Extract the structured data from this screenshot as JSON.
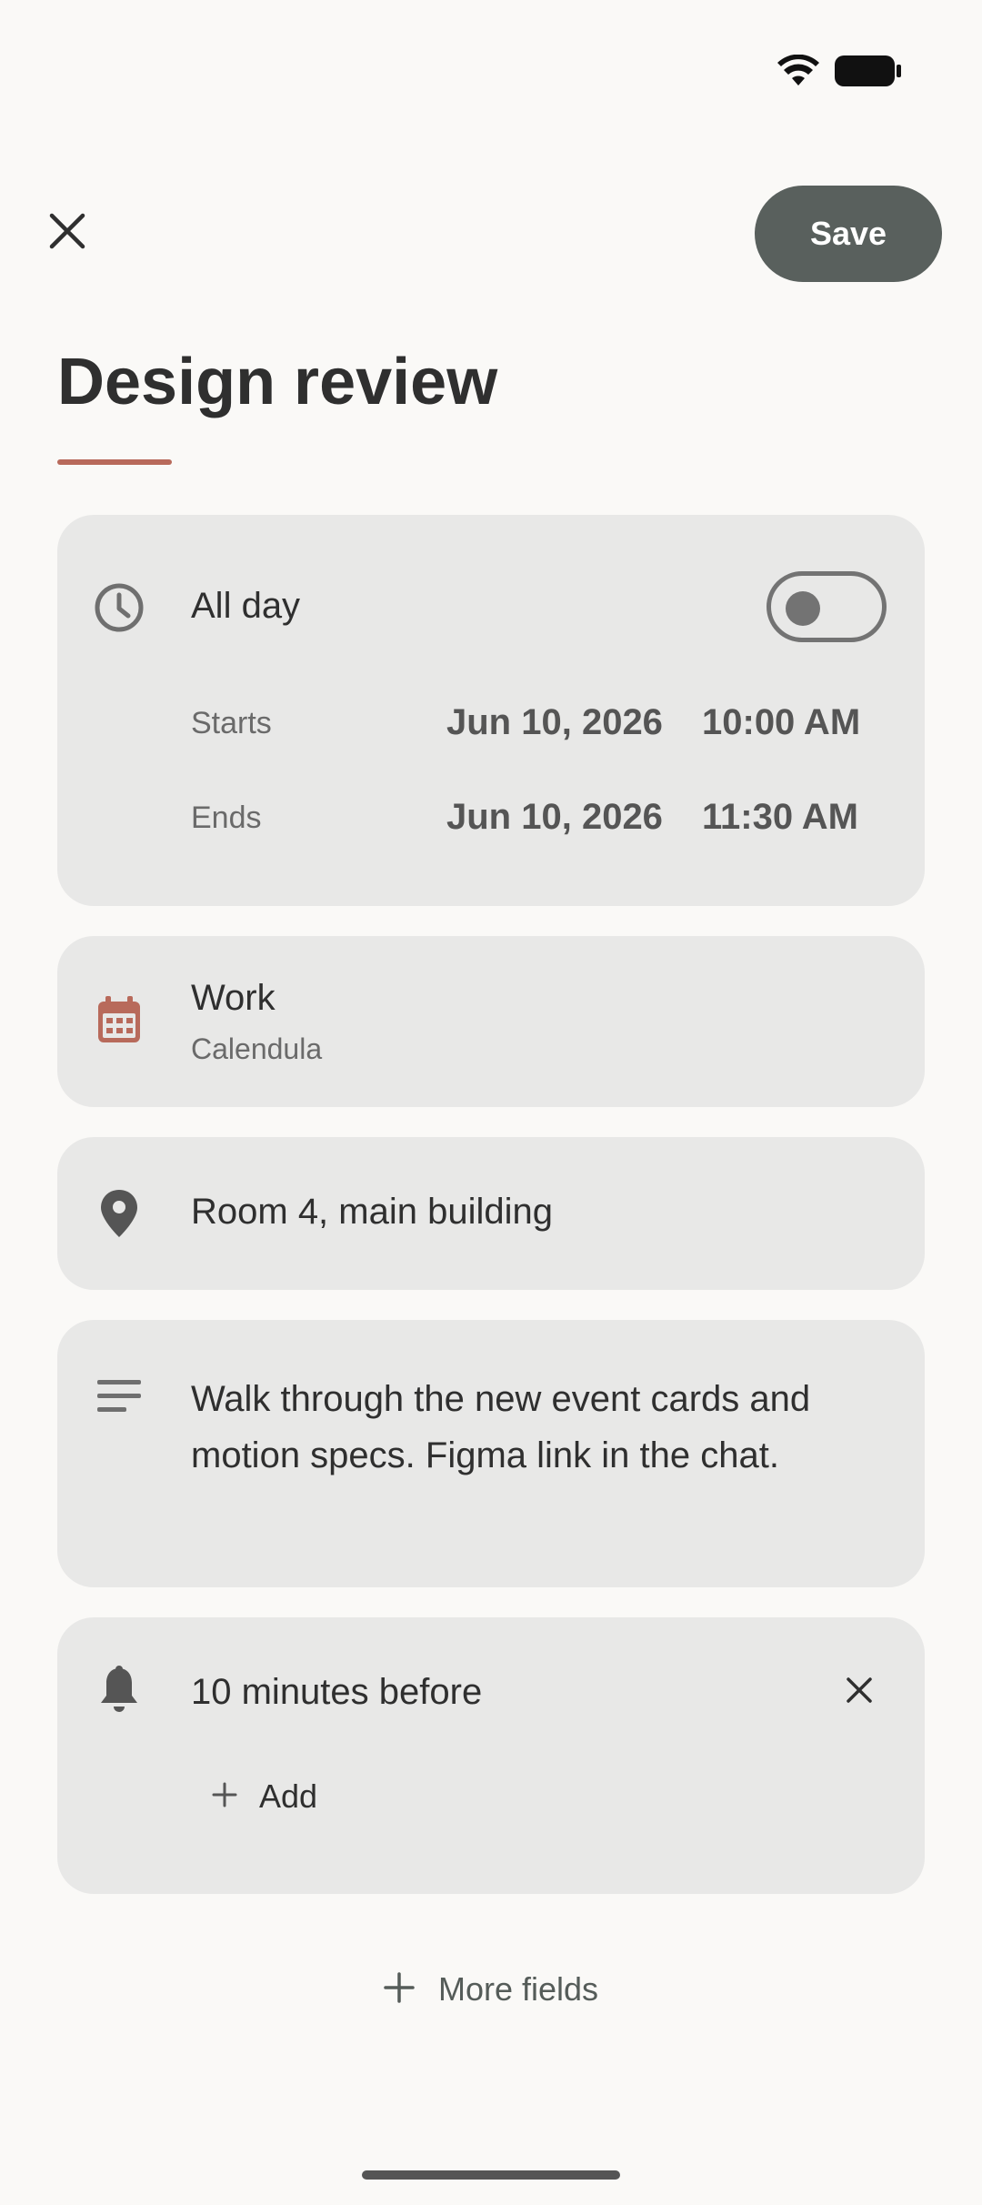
{
  "status_bar": {
    "wifi_icon": "wifi-icon",
    "battery_icon": "battery-icon"
  },
  "toolbar": {
    "close_icon": "close-icon",
    "save_label": "Save"
  },
  "event": {
    "title": "Design review"
  },
  "time_card": {
    "all_day_label": "All day",
    "all_day_enabled": false,
    "starts_label": "Starts",
    "start_date": "Jun 10, 2026",
    "start_time": "10:00 AM",
    "ends_label": "Ends",
    "end_date": "Jun 10, 2026",
    "end_time": "11:30 AM"
  },
  "calendar_card": {
    "calendar_name": "Work",
    "account_name": "Calendula"
  },
  "location_card": {
    "location": "Room 4, main building"
  },
  "description_card": {
    "description": "Walk through the new event cards and motion specs. Figma link in the chat."
  },
  "reminder_card": {
    "reminder": "10 minutes before",
    "add_label": "Add"
  },
  "footer": {
    "more_fields_label": "More fields"
  },
  "colors": {
    "background": "#FAF9F7",
    "card": "#E8E8E7",
    "save_button": "#59605D",
    "accent": "#B86A5B",
    "text": "#2F2F2F"
  }
}
